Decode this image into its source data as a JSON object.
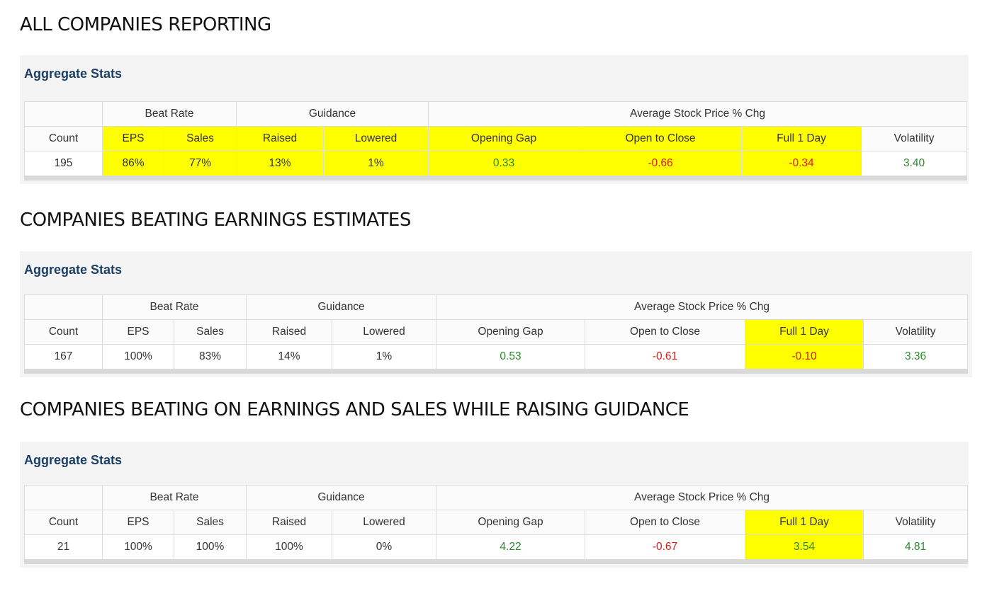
{
  "sections": [
    {
      "title": "ALL COMPANIES REPORTING",
      "panel_title": "Aggregate Stats",
      "group_headers": {
        "beat_rate": "Beat Rate",
        "guidance": "Guidance",
        "avg_price": "Average Stock Price % Chg"
      },
      "columns": [
        "Count",
        "EPS",
        "Sales",
        "Raised",
        "Lowered",
        "Opening Gap",
        "Open to Close",
        "Full 1 Day",
        "Volatility"
      ],
      "values": [
        "195",
        "86%",
        "77%",
        "13%",
        "1%",
        "0.33",
        "-0.66",
        "-0.34",
        "3.40"
      ],
      "highlighted_columns": [
        "EPS",
        "Sales",
        "Raised",
        "Lowered",
        "Opening Gap",
        "Open to Close",
        "Full 1 Day"
      ]
    },
    {
      "title": "COMPANIES BEATING EARNINGS ESTIMATES",
      "panel_title": "Aggregate Stats",
      "group_headers": {
        "beat_rate": "Beat Rate",
        "guidance": "Guidance",
        "avg_price": "Average Stock Price % Chg"
      },
      "columns": [
        "Count",
        "EPS",
        "Sales",
        "Raised",
        "Lowered",
        "Opening Gap",
        "Open to Close",
        "Full 1 Day",
        "Volatility"
      ],
      "values": [
        "167",
        "100%",
        "83%",
        "14%",
        "1%",
        "0.53",
        "-0.61",
        "-0.10",
        "3.36"
      ],
      "highlighted_columns": [
        "Full 1 Day"
      ]
    },
    {
      "title": "COMPANIES BEATING ON EARNINGS AND SALES WHILE RAISING GUIDANCE",
      "panel_title": "Aggregate Stats",
      "group_headers": {
        "beat_rate": "Beat Rate",
        "guidance": "Guidance",
        "avg_price": "Average Stock Price % Chg"
      },
      "columns": [
        "Count",
        "EPS",
        "Sales",
        "Raised",
        "Lowered",
        "Opening Gap",
        "Open to Close",
        "Full 1 Day",
        "Volatility"
      ],
      "values": [
        "21",
        "100%",
        "100%",
        "100%",
        "0%",
        "4.22",
        "-0.67",
        "3.54",
        "4.81"
      ],
      "highlighted_columns": [
        "Full 1 Day"
      ]
    }
  ],
  "colors": {
    "highlight": "#ffff00",
    "positive": "#2a8a2a",
    "negative": "#e01818",
    "panel_title": "#1c3f66"
  }
}
